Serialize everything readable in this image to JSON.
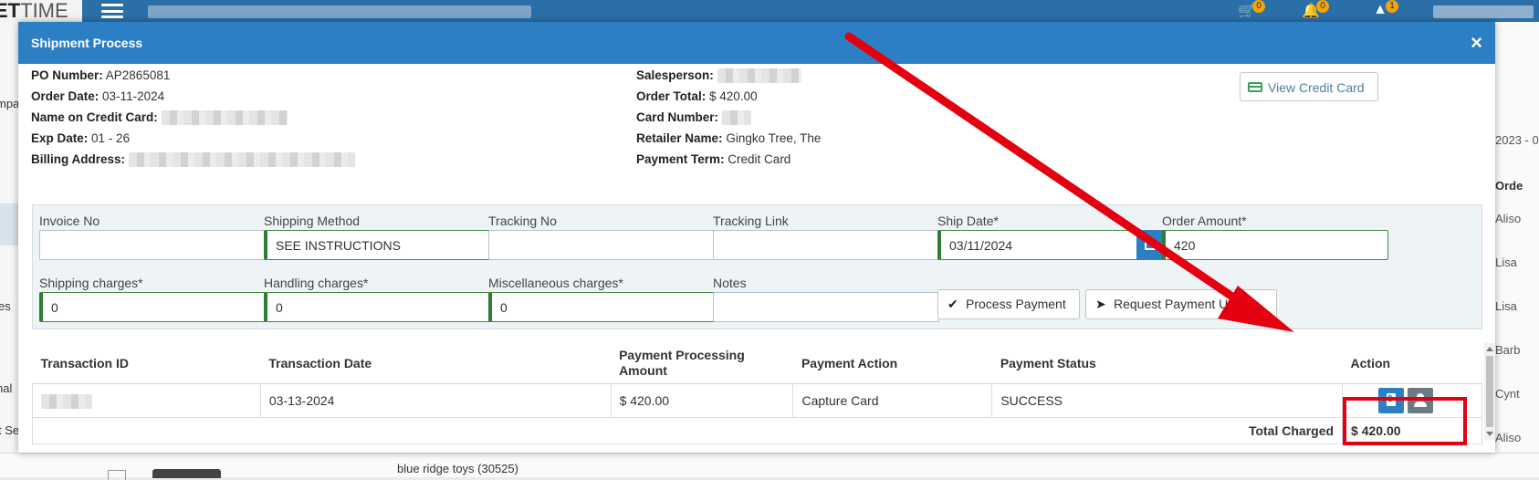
{
  "app": {
    "logo_text_a": "ET",
    "logo_text_b": "TIME",
    "badges": [
      "0",
      "0",
      "1"
    ]
  },
  "background": {
    "left_texts": [
      "mpa",
      "es",
      "nal",
      "t Se"
    ],
    "right_texts": [
      "2023 - 0",
      "Orde",
      "Aliso",
      "Lisa",
      "Lisa",
      "Barb",
      "Cynt",
      "Aliso"
    ],
    "bottom_row_text": "blue ridge toys (30525)"
  },
  "modal": {
    "title": "Shipment Process",
    "close": "×",
    "left_info": [
      {
        "label": "PO Number:",
        "value": "AP2865081"
      },
      {
        "label": "Order Date:",
        "value": "03-11-2024"
      },
      {
        "label": "Name on Credit Card:",
        "value": ""
      },
      {
        "label": "Exp Date:",
        "value": "01 - 26"
      },
      {
        "label": "Billing Address:",
        "value": ""
      }
    ],
    "right_info": [
      {
        "label": "Salesperson:",
        "value": ""
      },
      {
        "label": "Order Total:",
        "value": "$ 420.00"
      },
      {
        "label": "Card Number:",
        "value": ""
      },
      {
        "label": "Retailer Name:",
        "value": "Gingko Tree, The"
      },
      {
        "label": "Payment Term:",
        "value": "Credit Card"
      }
    ],
    "view_credit_card": "View Credit Card",
    "form": {
      "invoice_no": {
        "label": "Invoice No",
        "value": ""
      },
      "shipping_method": {
        "label": "Shipping Method",
        "value": "SEE INSTRUCTIONS"
      },
      "tracking_no": {
        "label": "Tracking No",
        "value": ""
      },
      "tracking_link": {
        "label": "Tracking Link",
        "value": ""
      },
      "ship_date": {
        "label": "Ship Date*",
        "value": "03/11/2024"
      },
      "order_amount": {
        "label": "Order Amount*",
        "value": "420"
      },
      "shipping_charges": {
        "label": "Shipping charges*",
        "value": "0"
      },
      "handling_charges": {
        "label": "Handling charges*",
        "value": "0"
      },
      "misc_charges": {
        "label": "Miscellaneous charges*",
        "value": "0"
      },
      "notes": {
        "label": "Notes",
        "value": ""
      }
    },
    "process_payment": "Process Payment",
    "request_payment_update": "Request Payment Update",
    "table": {
      "headers": [
        "Transaction ID",
        "Transaction Date",
        "Payment Processing Amount",
        "Payment Action",
        "Payment Status",
        "Action"
      ],
      "rows": [
        {
          "transaction_id": "",
          "date": "03-13-2024",
          "amount": "$ 420.00",
          "action": "Capture Card",
          "status": "SUCCESS"
        }
      ],
      "total_label": "Total Charged",
      "total_value": "$ 420.00"
    }
  },
  "colors": {
    "header_blue": "#2d7fc4",
    "success_green": "#2e7d32",
    "annotation_red": "#e3000f"
  }
}
